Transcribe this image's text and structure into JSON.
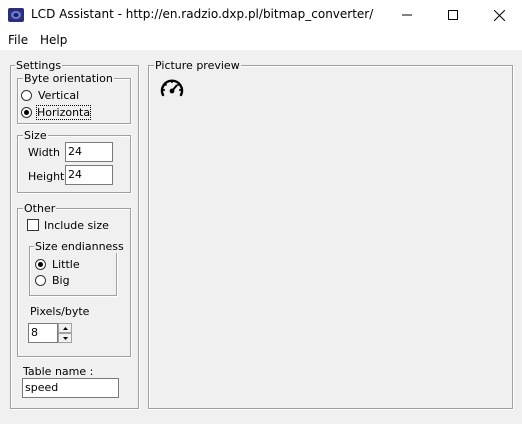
{
  "window": {
    "title": "LCD Assistant -  http://en.radzio.dxp.pl/bitmap_converter/",
    "app_icon": "lcd-assistant-icon",
    "minimize_icon": "minimize-icon",
    "maximize_icon": "maximize-icon",
    "close_icon": "close-icon"
  },
  "menu": {
    "items": [
      {
        "label": "File"
      },
      {
        "label": "Help"
      }
    ]
  },
  "settings": {
    "title": "Settings",
    "byte_orientation": {
      "title": "Byte orientation",
      "options": [
        {
          "label": "Vertical",
          "checked": false
        },
        {
          "label": "Horizonta",
          "checked": true
        }
      ]
    },
    "size": {
      "title": "Size",
      "width_label": "Width",
      "width_value": "24",
      "height_label": "Height",
      "height_value": "24"
    },
    "other": {
      "title": "Other",
      "include_size_label": "Include size",
      "include_size_checked": false,
      "endianness": {
        "title": "Size endianness",
        "options": [
          {
            "label": "Little",
            "checked": true
          },
          {
            "label": "Big",
            "checked": false
          }
        ]
      },
      "pixels_per_byte_label": "Pixels/byte",
      "pixels_per_byte_value": "8"
    },
    "table_name_label": "Table name :",
    "table_name_value": "speed"
  },
  "preview": {
    "title": "Picture preview",
    "image_icon": "speedometer-icon"
  }
}
